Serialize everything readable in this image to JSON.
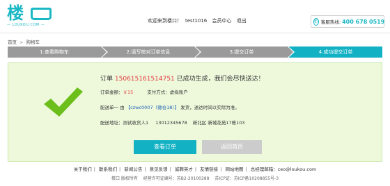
{
  "header": {
    "logo_main": "楼",
    "logo_sub": "— LOUKOU.COM —",
    "welcome_text": "欢迎来到楼口！",
    "username": "test1016",
    "member_center": "会员中心",
    "logout": "退出",
    "hotline_label": "客服热线:",
    "hotline_number": "400 678 0519",
    "phone_icon": "phone-icon"
  },
  "breadcrumb": {
    "home": "首页",
    "separator": ">",
    "current": "购物车"
  },
  "steps": [
    {
      "label": "1.查看购物车"
    },
    {
      "label": "2.填写核对订单信息"
    },
    {
      "label": "3.提交订单"
    },
    {
      "label": "4.成功提交订单"
    }
  ],
  "colors": {
    "step_inactive": "#9a9a9a",
    "step_active": "#12b2c4",
    "panel_bg": "#eef9dc",
    "brand": "#1ab7c4",
    "check": "#6cbf1b",
    "price": "#e4393c"
  },
  "order": {
    "prefix": "订单",
    "number": "150615161514751",
    "suffix": "已成功生成，我们会尽快送达！",
    "amount_label": "订单金额：",
    "amount_value": "￥15",
    "payment_label": "支付方式：虚拟账户",
    "dispatch_prefix": "配送单一 由",
    "dispatch_store": "【czwc0007（微仓18）】",
    "dispatch_suffix": "发货，送达时间以实际为准。",
    "address_label": "配送地址：",
    "receiver": "测试收货人1",
    "phone": "13012345678",
    "address": "新北区 新城花苑17栋103"
  },
  "buttons": {
    "view_order": "查看订单",
    "back_home": "返回首页"
  },
  "footer": {
    "links": [
      "关于我们",
      "联系我们",
      "新闻公告",
      "意见反馈",
      "诚聘英才",
      "友情链接",
      "网站地图",
      "总经理邮箱：ceo@loukou.com"
    ],
    "copyright": "楼口 版权所有",
    "license": "经营许可证编号：苏B2-20100288",
    "icp": "苏ICP证：苏ICP备10208855号-3"
  }
}
